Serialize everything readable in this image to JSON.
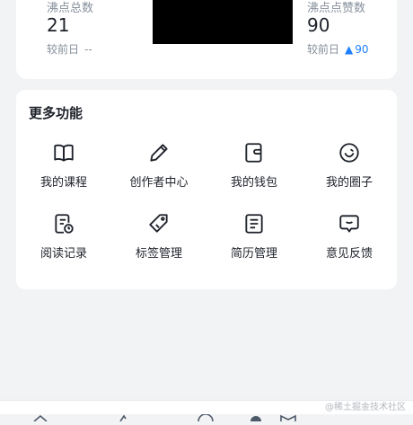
{
  "stats": {
    "left": {
      "label": "沸点总数",
      "value": "21",
      "compare_label": "较前日",
      "compare_value": "--"
    },
    "right": {
      "label": "沸点点赞数",
      "value": "90",
      "compare_label": "较前日",
      "compare_value": "90",
      "trend_icon": "triangle-up-icon"
    }
  },
  "more": {
    "title": "更多功能",
    "items": [
      {
        "label": "我的课程",
        "icon": "book-icon"
      },
      {
        "label": "创作者中心",
        "icon": "pencil-icon"
      },
      {
        "label": "我的钱包",
        "icon": "wallet-icon"
      },
      {
        "label": "我的圈子",
        "icon": "smile-circle-icon"
      },
      {
        "label": "阅读记录",
        "icon": "reading-history-icon"
      },
      {
        "label": "标签管理",
        "icon": "tag-icon"
      },
      {
        "label": "简历管理",
        "icon": "resume-icon"
      },
      {
        "label": "意见反馈",
        "icon": "feedback-icon"
      }
    ]
  },
  "watermark": "@稀土掘金技术社区",
  "colors": {
    "accent": "#1e80ff",
    "muted": "#86909c",
    "text": "#1d2129",
    "bg": "#f2f3f5"
  }
}
